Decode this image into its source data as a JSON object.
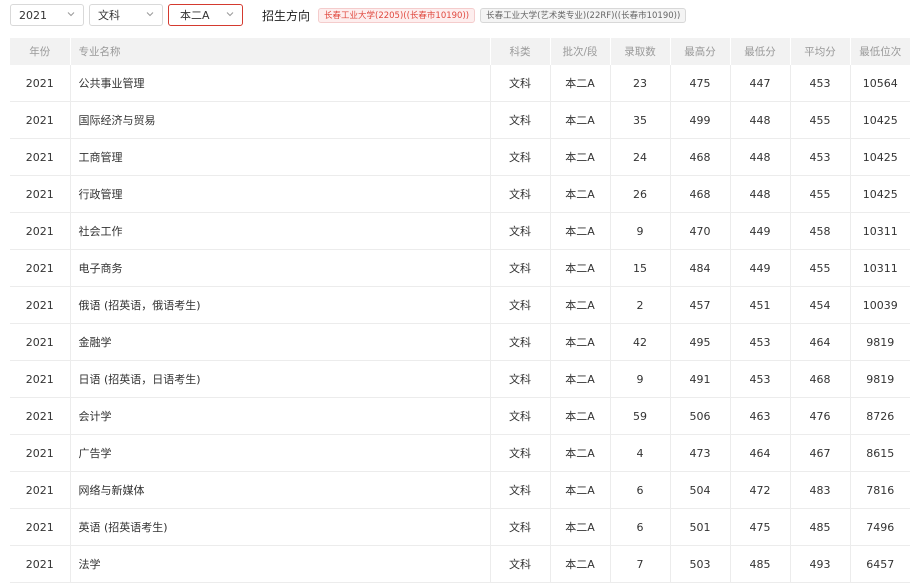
{
  "filters": {
    "year": "2021",
    "subject": "文科",
    "batch": "本二A"
  },
  "direction_label": "招生方向",
  "direction_tags": [
    "长春工业大学(2205)((长春市10190))",
    "长春工业大学(艺术类专业)(22RF)((长春市10190))"
  ],
  "table": {
    "headers": [
      "年份",
      "专业名称",
      "科类",
      "批次/段",
      "录取数",
      "最高分",
      "最低分",
      "平均分",
      "最低位次"
    ],
    "rows": [
      [
        "2021",
        "公共事业管理",
        "文科",
        "本二A",
        "23",
        "475",
        "447",
        "453",
        "10564"
      ],
      [
        "2021",
        "国际经济与贸易",
        "文科",
        "本二A",
        "35",
        "499",
        "448",
        "455",
        "10425"
      ],
      [
        "2021",
        "工商管理",
        "文科",
        "本二A",
        "24",
        "468",
        "448",
        "453",
        "10425"
      ],
      [
        "2021",
        "行政管理",
        "文科",
        "本二A",
        "26",
        "468",
        "448",
        "455",
        "10425"
      ],
      [
        "2021",
        "社会工作",
        "文科",
        "本二A",
        "9",
        "470",
        "449",
        "458",
        "10311"
      ],
      [
        "2021",
        "电子商务",
        "文科",
        "本二A",
        "15",
        "484",
        "449",
        "455",
        "10311"
      ],
      [
        "2021",
        "俄语 (招英语，俄语考生)",
        "文科",
        "本二A",
        "2",
        "457",
        "451",
        "454",
        "10039"
      ],
      [
        "2021",
        "金融学",
        "文科",
        "本二A",
        "42",
        "495",
        "453",
        "464",
        "9819"
      ],
      [
        "2021",
        "日语 (招英语，日语考生)",
        "文科",
        "本二A",
        "9",
        "491",
        "453",
        "468",
        "9819"
      ],
      [
        "2021",
        "会计学",
        "文科",
        "本二A",
        "59",
        "506",
        "463",
        "476",
        "8726"
      ],
      [
        "2021",
        "广告学",
        "文科",
        "本二A",
        "4",
        "473",
        "464",
        "467",
        "8615"
      ],
      [
        "2021",
        "网络与新媒体",
        "文科",
        "本二A",
        "6",
        "504",
        "472",
        "483",
        "7816"
      ],
      [
        "2021",
        "英语 (招英语考生)",
        "文科",
        "本二A",
        "6",
        "501",
        "475",
        "485",
        "7496"
      ],
      [
        "2021",
        "法学",
        "文科",
        "本二A",
        "7",
        "503",
        "485",
        "493",
        "6457"
      ]
    ]
  },
  "colors": {
    "accent": "#d43a2f",
    "header_bg": "#f2f2f2"
  }
}
